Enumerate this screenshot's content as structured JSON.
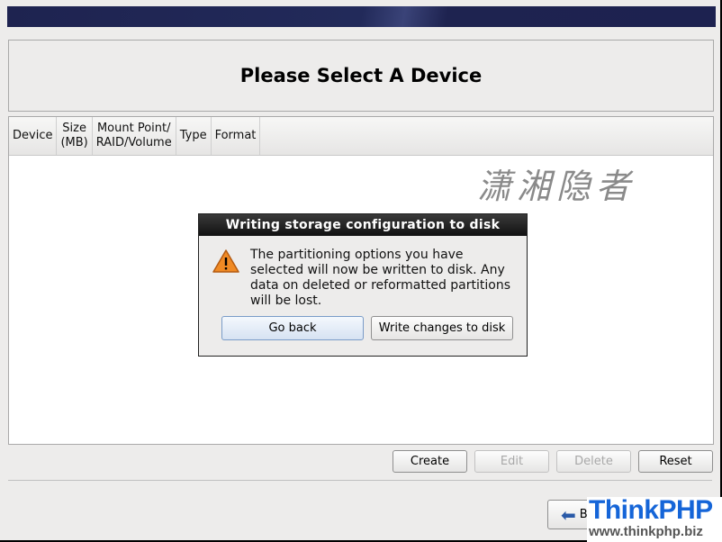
{
  "header": {
    "title": "Please Select A Device"
  },
  "table": {
    "columns": [
      "Device",
      "Size\n(MB)",
      "Mount Point/\nRAID/Volume",
      "Type",
      "Format"
    ]
  },
  "watermark": "潇湘隐者",
  "buttons": {
    "create": "Create",
    "edit": "Edit",
    "delete": "Delete",
    "reset": "Reset",
    "back": "Back"
  },
  "dialog": {
    "title": "Writing storage configuration to disk",
    "message": "The partitioning options you have selected will now be written to disk.  Any data on deleted or reformatted partitions will be lost.",
    "go_back": "Go back",
    "write": "Write changes to disk",
    "icon": "warning-icon"
  },
  "logo": {
    "name": "ThinkPHP",
    "url": "www.thinkphp.biz"
  },
  "colors": {
    "banner": "#1e2350",
    "logo": "#1565d8",
    "warning": "#f08a24"
  }
}
